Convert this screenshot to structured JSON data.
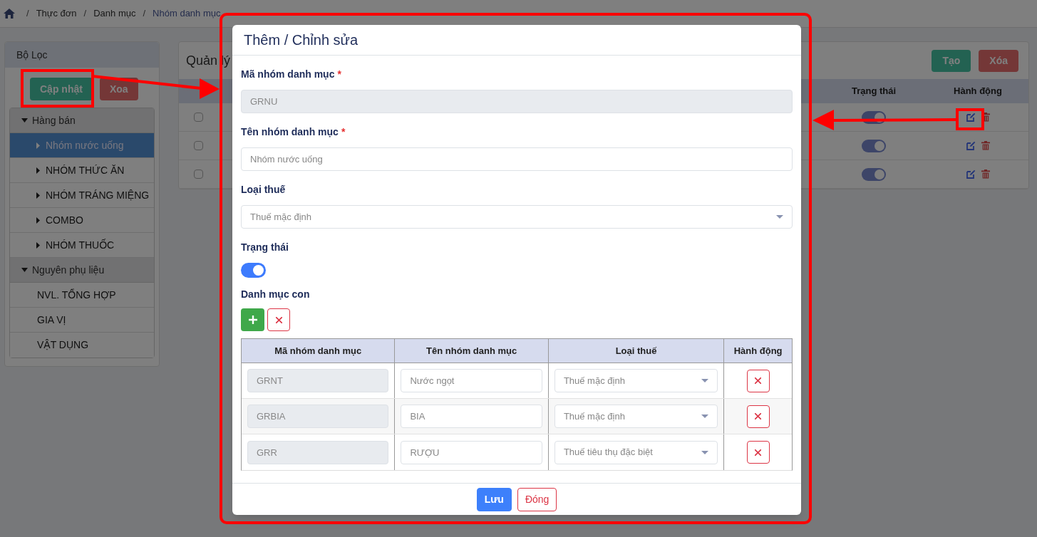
{
  "breadcrumb": [
    {
      "separator": "/",
      "label": "Thực đơn",
      "current": false
    },
    {
      "separator": "/",
      "label": "Danh mục",
      "current": false
    },
    {
      "separator": "/",
      "label": "Nhóm danh mục",
      "current": true
    }
  ],
  "filter_panel": {
    "title": "Bộ Lọc",
    "buttons": [
      {
        "label": "Cập nhật",
        "kind": "save"
      },
      {
        "label": "Xoa",
        "kind": "delete"
      }
    ],
    "tree": [
      {
        "label": "Hàng bán",
        "expanded": true,
        "children": [
          {
            "label": "Nhóm nước uống",
            "expandable": true,
            "selected": true
          },
          {
            "label": "NHÓM THỨC ĂN",
            "expandable": true,
            "selected": false
          },
          {
            "label": "NHÓM TRÁNG MIỆNG",
            "expandable": true,
            "selected": false
          },
          {
            "label": "COMBO",
            "expandable": true,
            "selected": false
          },
          {
            "label": "NHÓM THUỐC",
            "expandable": true,
            "selected": false
          }
        ]
      },
      {
        "label": "Nguyên phụ liệu",
        "expanded": true,
        "children": [
          {
            "label": "NVL. TỔNG HỢP",
            "expandable": false,
            "selected": false
          },
          {
            "label": "GIA VỊ",
            "expandable": false,
            "selected": false
          },
          {
            "label": "VẬT DỤNG",
            "expandable": false,
            "selected": false
          }
        ]
      }
    ]
  },
  "main": {
    "title": "Quản lý",
    "buttons": [
      {
        "label": "Tạo",
        "kind": "save"
      },
      {
        "label": "Xóa",
        "kind": "delete"
      }
    ],
    "columns": [
      "Trạng thái",
      "Hành động"
    ],
    "rows": [
      {
        "checked": false,
        "on": true
      },
      {
        "checked": false,
        "on": true
      },
      {
        "checked": false,
        "on": true
      }
    ]
  },
  "modal": {
    "title": "Thêm / Chỉnh sửa",
    "fields": [
      {
        "kind": "text",
        "label": "Mã nhóm danh mục",
        "required_mark": "*",
        "value": "GRNU",
        "disabled": true
      },
      {
        "kind": "text",
        "label": "Tên nhóm danh mục",
        "required_mark": "*",
        "value": "Nhóm nước uống",
        "disabled": false
      },
      {
        "kind": "select",
        "label": "Loại thuế",
        "value": "Thuế mặc định"
      },
      {
        "kind": "toggle",
        "label": "Trạng thái",
        "on": true
      }
    ],
    "subcategories": {
      "label": "Danh mục con",
      "columns": [
        "Mã nhóm danh mục",
        "Tên nhóm danh mục",
        "Loại thuế",
        "Hành động"
      ],
      "rows": [
        {
          "code": "GRNT",
          "name": "Nước ngọt",
          "tax": "Thuế mặc định"
        },
        {
          "code": "GRBIA",
          "name": "BIA",
          "tax": "Thuế mặc định"
        },
        {
          "code": "GRR",
          "name": "RƯỢU",
          "tax": "Thuế tiêu thụ đặc biệt"
        }
      ]
    },
    "footer_buttons": [
      {
        "label": "Lưu",
        "kind": "primary"
      },
      {
        "label": "Đóng",
        "kind": "outline"
      }
    ]
  }
}
